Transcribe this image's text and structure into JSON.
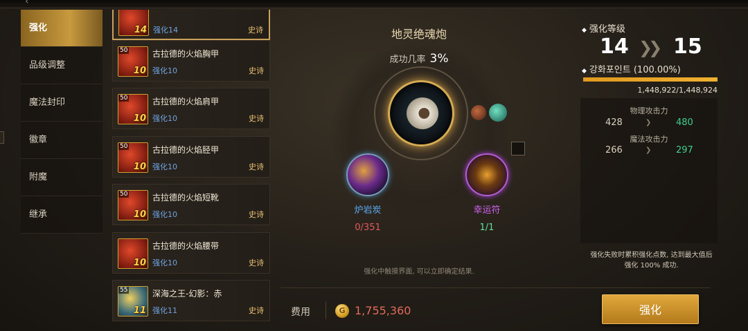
{
  "menu": {
    "tabs": [
      {
        "label": "强化"
      },
      {
        "label": "品级调整"
      },
      {
        "label": "魔法封印"
      },
      {
        "label": "徽章"
      },
      {
        "label": "附魔"
      },
      {
        "label": "继承"
      }
    ]
  },
  "items": [
    {
      "name": "",
      "level_label": "强化14",
      "grade": "史诗",
      "thumb_level": "14",
      "thumb_tag": ""
    },
    {
      "name": "古拉德的火焰胸甲",
      "level_label": "强化10",
      "grade": "史诗",
      "thumb_level": "10",
      "thumb_tag": "50"
    },
    {
      "name": "古拉德的火焰肩甲",
      "level_label": "强化10",
      "grade": "史诗",
      "thumb_level": "10",
      "thumb_tag": "50"
    },
    {
      "name": "古拉德的火焰胫甲",
      "level_label": "强化10",
      "grade": "史诗",
      "thumb_level": "10",
      "thumb_tag": "50"
    },
    {
      "name": "古拉德的火焰短靴",
      "level_label": "强化10",
      "grade": "史诗",
      "thumb_level": "10",
      "thumb_tag": "50"
    },
    {
      "name": "古拉德的火焰腰带",
      "level_label": "强化10",
      "grade": "史诗",
      "thumb_level": "10",
      "thumb_tag": ""
    },
    {
      "name": "深海之王-幻影：赤",
      "level_label": "强化11",
      "grade": "史诗",
      "thumb_level": "11",
      "thumb_tag": "55"
    }
  ],
  "center": {
    "title": "地灵绝魂炮",
    "rate_label": "成功几率",
    "rate_value": "3%",
    "materials": [
      {
        "name": "炉岩炭",
        "count": "0/351",
        "name_color": "#5aa8f0",
        "count_color": "#e05a5a"
      },
      {
        "name": "幸运符",
        "count": "1/1",
        "name_color": "#d060f0",
        "count_color": "#60e0a0"
      }
    ],
    "hint": "强化中触摸界面, 可以立即确定结果."
  },
  "cost": {
    "label": "费用",
    "coin_symbol": "G",
    "value": "1,755,360"
  },
  "right": {
    "level_header": "强化等级",
    "level_from": "14",
    "level_to": "15",
    "points_label": "강화포인트 (100.00%)",
    "points_fraction": 1.0,
    "points_value": "1,448,922/1,448,924",
    "stats": [
      {
        "name": "物理攻击力",
        "old": "428",
        "new": "480"
      },
      {
        "name": "魔法攻击力",
        "old": "266",
        "new": "297"
      }
    ],
    "note": "强化失败时累积强化点数, 达到最大值后强化 100% 成功.",
    "button_label": "强化"
  },
  "colors": {
    "accent": "#c89a3e",
    "increase": "#40d090",
    "cost": "#e06a5a"
  }
}
